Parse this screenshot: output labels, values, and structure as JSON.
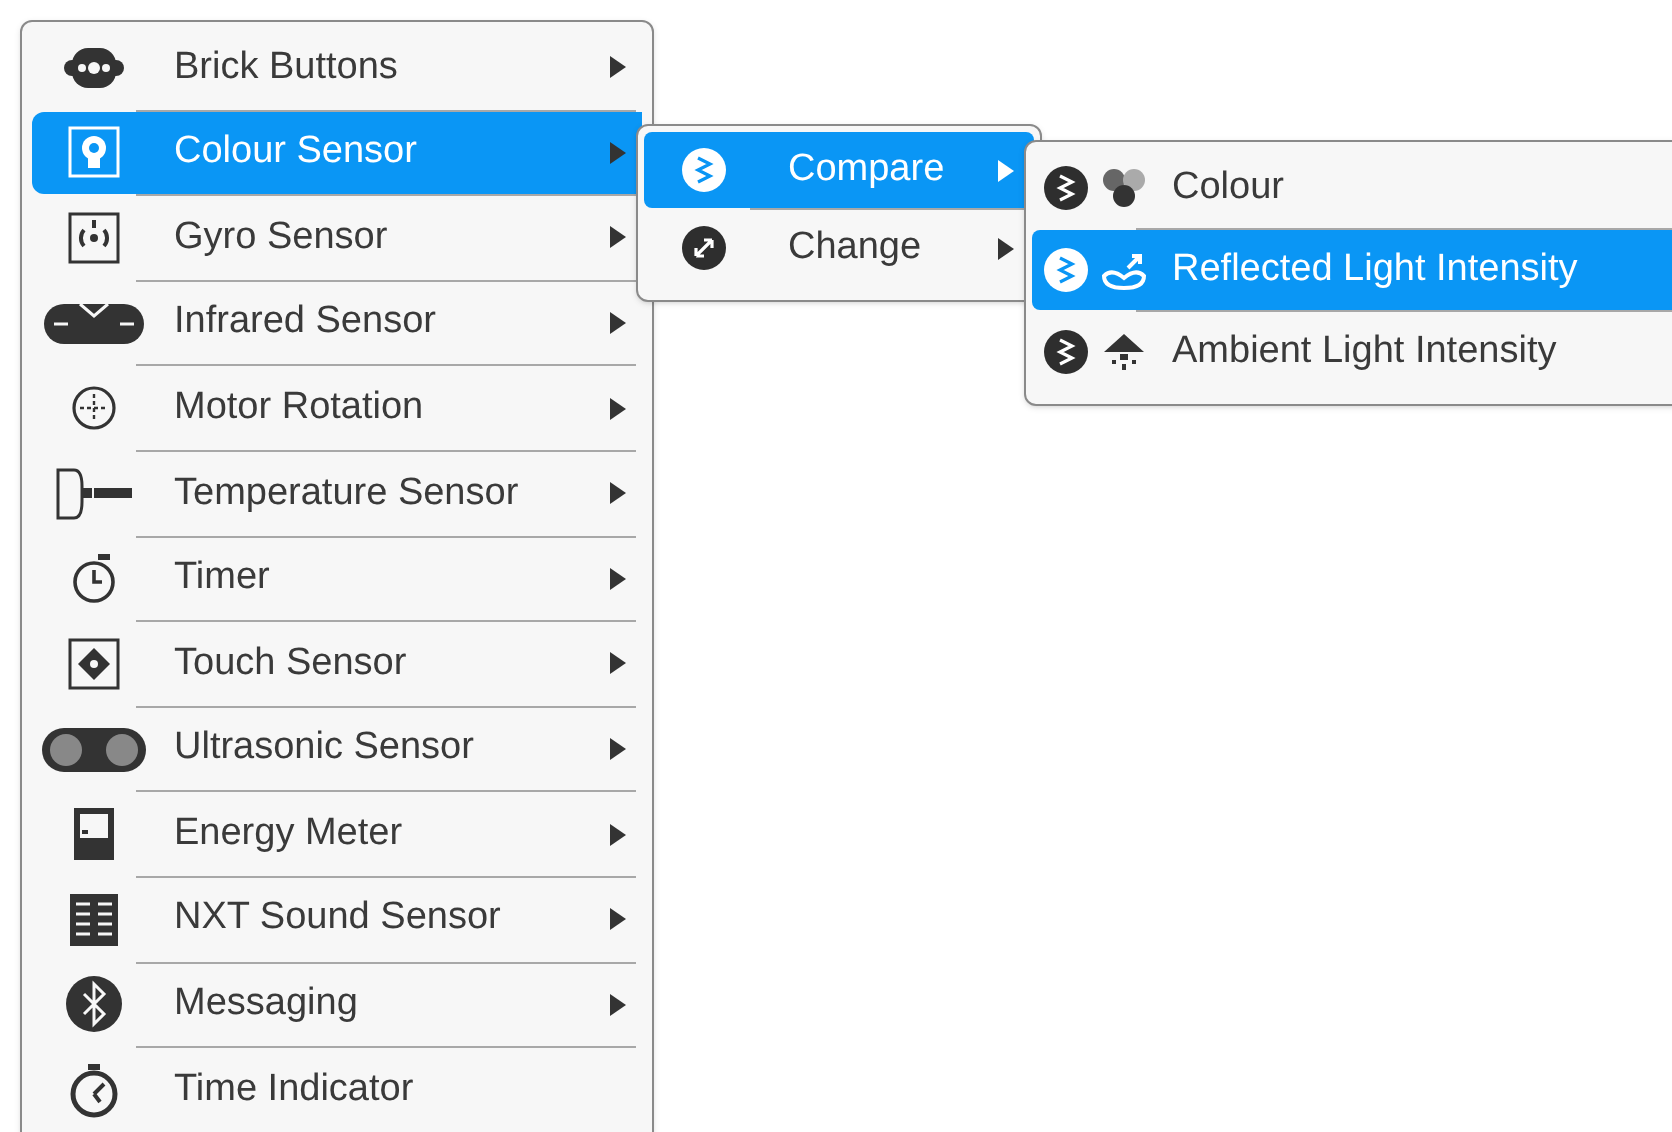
{
  "main_menu": {
    "items": [
      {
        "label": "Brick Buttons",
        "selected": false,
        "has_submenu": true
      },
      {
        "label": "Colour Sensor",
        "selected": true,
        "has_submenu": true
      },
      {
        "label": "Gyro Sensor",
        "selected": false,
        "has_submenu": true
      },
      {
        "label": "Infrared Sensor",
        "selected": false,
        "has_submenu": true
      },
      {
        "label": "Motor Rotation",
        "selected": false,
        "has_submenu": true
      },
      {
        "label": "Temperature Sensor",
        "selected": false,
        "has_submenu": true
      },
      {
        "label": "Timer",
        "selected": false,
        "has_submenu": true
      },
      {
        "label": "Touch Sensor",
        "selected": false,
        "has_submenu": true
      },
      {
        "label": "Ultrasonic Sensor",
        "selected": false,
        "has_submenu": true
      },
      {
        "label": "Energy Meter",
        "selected": false,
        "has_submenu": true
      },
      {
        "label": "NXT Sound Sensor",
        "selected": false,
        "has_submenu": true
      },
      {
        "label": "Messaging",
        "selected": false,
        "has_submenu": true
      },
      {
        "label": "Time Indicator",
        "selected": false,
        "has_submenu": false
      }
    ]
  },
  "mode_menu": {
    "items": [
      {
        "label": "Compare",
        "selected": true,
        "has_submenu": true
      },
      {
        "label": "Change",
        "selected": false,
        "has_submenu": true
      }
    ]
  },
  "compare_menu": {
    "items": [
      {
        "label": "Colour",
        "selected": false
      },
      {
        "label": "Reflected Light Intensity",
        "selected": true
      },
      {
        "label": "Ambient Light Intensity",
        "selected": false
      }
    ]
  }
}
